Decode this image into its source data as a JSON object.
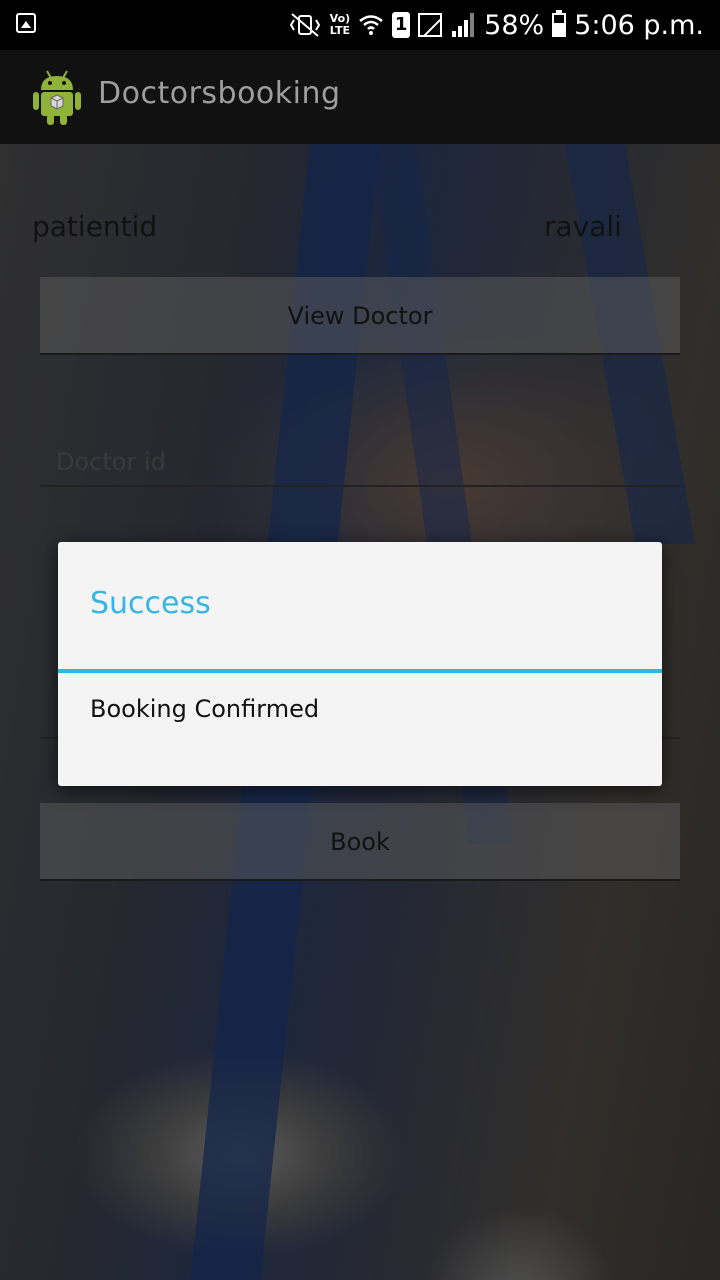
{
  "status_bar": {
    "volte": "Vo)",
    "lte": "LTE",
    "sim": "1",
    "battery": "58%",
    "time": "5:06 p.m."
  },
  "app": {
    "title": "Doctorsbooking",
    "icon": "android-robot-icon"
  },
  "form": {
    "patient_label": "patientid",
    "patient_value": "ravali",
    "view_doctor_label": "View Doctor",
    "doctor_id_placeholder": "Doctor id",
    "book_label": "Book"
  },
  "dialog": {
    "title": "Success",
    "message": "Booking Confirmed"
  },
  "colors": {
    "accent": "#33b5e5",
    "dialog_bg": "#f4f4f4",
    "action_bar": "#111111"
  }
}
